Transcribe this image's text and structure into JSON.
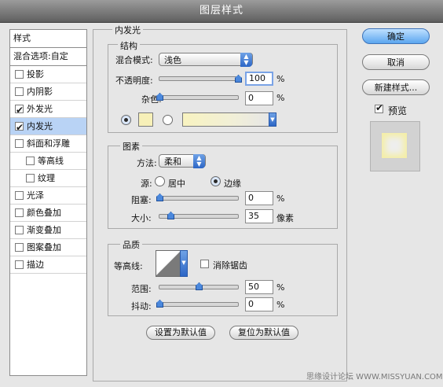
{
  "window": {
    "title": "图层样式"
  },
  "styles_list": {
    "header": "样式",
    "blend_options": "混合选项:自定",
    "items": [
      {
        "label": "投影",
        "checked": false,
        "selected": false,
        "indent": false
      },
      {
        "label": "内阴影",
        "checked": false,
        "selected": false,
        "indent": false
      },
      {
        "label": "外发光",
        "checked": true,
        "selected": false,
        "indent": false
      },
      {
        "label": "内发光",
        "checked": true,
        "selected": true,
        "indent": false
      },
      {
        "label": "斜面和浮雕",
        "checked": false,
        "selected": false,
        "indent": false
      },
      {
        "label": "等高线",
        "checked": false,
        "selected": false,
        "indent": true
      },
      {
        "label": "纹理",
        "checked": false,
        "selected": false,
        "indent": true
      },
      {
        "label": "光泽",
        "checked": false,
        "selected": false,
        "indent": false
      },
      {
        "label": "颜色叠加",
        "checked": false,
        "selected": false,
        "indent": false
      },
      {
        "label": "渐变叠加",
        "checked": false,
        "selected": false,
        "indent": false
      },
      {
        "label": "图案叠加",
        "checked": false,
        "selected": false,
        "indent": false
      },
      {
        "label": "描边",
        "checked": false,
        "selected": false,
        "indent": false
      }
    ]
  },
  "inner_glow": {
    "title": "内发光",
    "structure": {
      "title": "结构",
      "blend_mode_label": "混合模式:",
      "blend_mode_value": "浅色",
      "opacity_label": "不透明度:",
      "opacity_value": "100",
      "opacity_unit": "%",
      "opacity_level": 1.0,
      "noise_label": "杂色:",
      "noise_value": "0",
      "noise_unit": "%",
      "noise_level": 0.0,
      "glow_color": "#f7f0b8"
    },
    "elements": {
      "title": "图素",
      "technique_label": "方法:",
      "technique_value": "柔和",
      "source_label": "源:",
      "source_center": "居中",
      "source_edge": "边缘",
      "choke_label": "阻塞:",
      "choke_value": "0",
      "choke_unit": "%",
      "choke_level": 0.0,
      "size_label": "大小:",
      "size_value": "35",
      "size_unit": "像素",
      "size_level": 0.14
    },
    "quality": {
      "title": "品质",
      "contour_label": "等高线:",
      "anti_alias_label": "消除锯齿",
      "range_label": "范围:",
      "range_value": "50",
      "range_unit": "%",
      "range_level": 0.5,
      "jitter_label": "抖动:",
      "jitter_value": "0",
      "jitter_unit": "%",
      "jitter_level": 0.0
    },
    "make_default": "设置为默认值",
    "reset_default": "复位为默认值"
  },
  "buttons": {
    "ok": "确定",
    "cancel": "取消",
    "new_style": "新建样式...",
    "preview_label": "预览"
  },
  "watermark": "思缘设计论坛 WWW.MISSYUAN.COM"
}
